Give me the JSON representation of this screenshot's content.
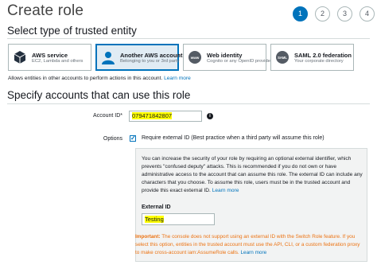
{
  "header": {
    "title": "Create role",
    "steps": [
      "1",
      "2",
      "3",
      "4"
    ],
    "active_step": 1
  },
  "trusted_entity": {
    "section_title": "Select type of trusted entity",
    "cards": [
      {
        "title": "AWS service",
        "subtitle": "EC2, Lambda and others",
        "icon": "cube-icon",
        "selected": false
      },
      {
        "title": "Another AWS account",
        "subtitle": "Belonging to you or 3rd party",
        "icon": "user-icon",
        "selected": true
      },
      {
        "title": "Web identity",
        "subtitle": "Cognito or any OpenID provider",
        "icon": "www-icon",
        "selected": false
      },
      {
        "title": "SAML 2.0 federation",
        "subtitle": "Your corporate directory",
        "icon": "saml-icon",
        "selected": false
      }
    ],
    "help_text": "Allows entities in other accounts to perform actions in this account.",
    "help_link": "Learn more"
  },
  "accounts": {
    "section_title": "Specify accounts that can use this role",
    "account_id_label": "Account ID*",
    "account_id_value": "079471842807",
    "options_label": "Options",
    "require_external_id_label": "Require external ID (Best practice when a third party will assume this role)",
    "require_external_id_checked": true
  },
  "external_id_panel": {
    "description": "You can increase the security of your role by requiring an optional external identifier, which prevents \"confused deputy\" attacks. This is recommended if you do not own or have administrative access to the account that can assume this role. The external ID can include any characters that you choose. To assume this role, users must be in the trusted account and provide this exact external ID.",
    "description_link": "Learn more",
    "external_id_label": "External ID",
    "external_id_value": "Testing",
    "important_label": "Important:",
    "important_text": "The console does not support using an external ID with the Switch Role feature. If you select this option, entities in the trusted account must use the API, CLI, or a custom federation proxy to make cross-account iam:AssumeRole calls.",
    "important_link": "Learn more"
  },
  "colors": {
    "accent": "#0073bb",
    "highlight": "#ffff00",
    "warning": "#ec7211"
  }
}
